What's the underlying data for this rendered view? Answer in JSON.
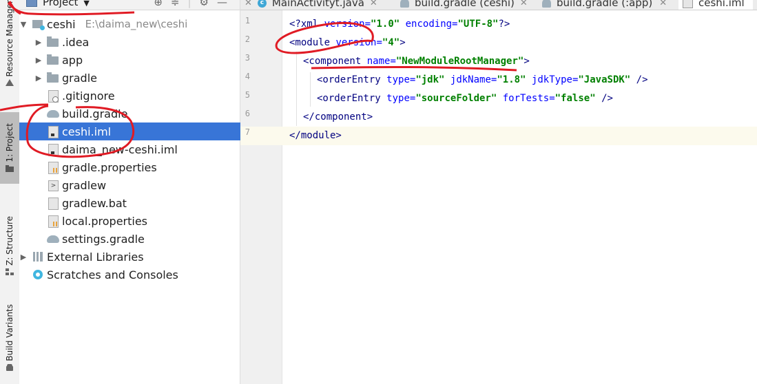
{
  "strip": {
    "tabs": [
      {
        "label": "Resource Manager"
      },
      {
        "label": "1: Project"
      },
      {
        "label": "Z: Structure"
      },
      {
        "label": "Build Variants"
      }
    ]
  },
  "project": {
    "title": "Project",
    "tree": [
      {
        "label": "ceshi",
        "path": "E:\\daima_new\\ceshi",
        "icon": "module-icon"
      },
      {
        "label": ".idea",
        "icon": "folder-icon"
      },
      {
        "label": "app",
        "icon": "folder-icon"
      },
      {
        "label": "gradle",
        "icon": "folder-icon"
      },
      {
        "label": ".gitignore",
        "icon": "gitignore-file-icon"
      },
      {
        "label": "build.gradle",
        "icon": "gradle-icon"
      },
      {
        "label": "ceshi.iml",
        "icon": "iml-file-icon"
      },
      {
        "label": "daima_new-ceshi.iml",
        "icon": "iml-file-icon"
      },
      {
        "label": "gradle.properties",
        "icon": "properties-file-icon"
      },
      {
        "label": "gradlew",
        "icon": "terminal-file-icon"
      },
      {
        "label": "gradlew.bat",
        "icon": "text-file-icon"
      },
      {
        "label": "local.properties",
        "icon": "properties-file-icon"
      },
      {
        "label": "settings.gradle",
        "icon": "gradle-icon"
      },
      {
        "label": "External Libraries",
        "icon": "libraries-icon"
      },
      {
        "label": "Scratches and Consoles",
        "icon": "scratch-icon"
      }
    ]
  },
  "tabs": [
    {
      "label": "MainActivityt.java"
    },
    {
      "label": "build.gradle (ceshi)"
    },
    {
      "label": "build.gradle (:app)"
    },
    {
      "label": "ceshi.iml"
    }
  ],
  "editor": {
    "line_numbers": [
      "1",
      "2",
      "3",
      "4",
      "5",
      "6",
      "7"
    ],
    "lines": {
      "l1": {
        "open": "<?xml ",
        "a1": "version",
        "e1": "=",
        "v1": "\"1.0\"",
        "a2": " encoding",
        "e2": "=",
        "v2": "\"UTF-8\"",
        "close": "?>"
      },
      "l2": {
        "open": "<module ",
        "a1": "version",
        "e1": "=",
        "v1": "\"4\"",
        "close": ">"
      },
      "l3": {
        "open": "<component ",
        "a1": "name",
        "e1": "=",
        "v1": "\"NewModuleRootManager\"",
        "close": ">"
      },
      "l4": {
        "open": "<orderEntry ",
        "a1": "type",
        "e1": "=",
        "v1": "\"jdk\"",
        "a2": " jdkName",
        "e2": "=",
        "v2": "\"1.8\"",
        "a3": " jdkType",
        "e3": "=",
        "v3": "\"JavaSDK\"",
        "close": " />"
      },
      "l5": {
        "open": "<orderEntry ",
        "a1": "type",
        "e1": "=",
        "v1": "\"sourceFolder\"",
        "a2": " forTests",
        "e2": "=",
        "v2": "\"false\"",
        "close": " />"
      },
      "l6": {
        "text": "</component>"
      },
      "l7": {
        "text": "</module>"
      }
    }
  },
  "colors": {
    "selection": "#3875d7",
    "tag": "#000080",
    "attribute": "#0000ff",
    "value": "#008000",
    "annotation": "#e01b24"
  }
}
